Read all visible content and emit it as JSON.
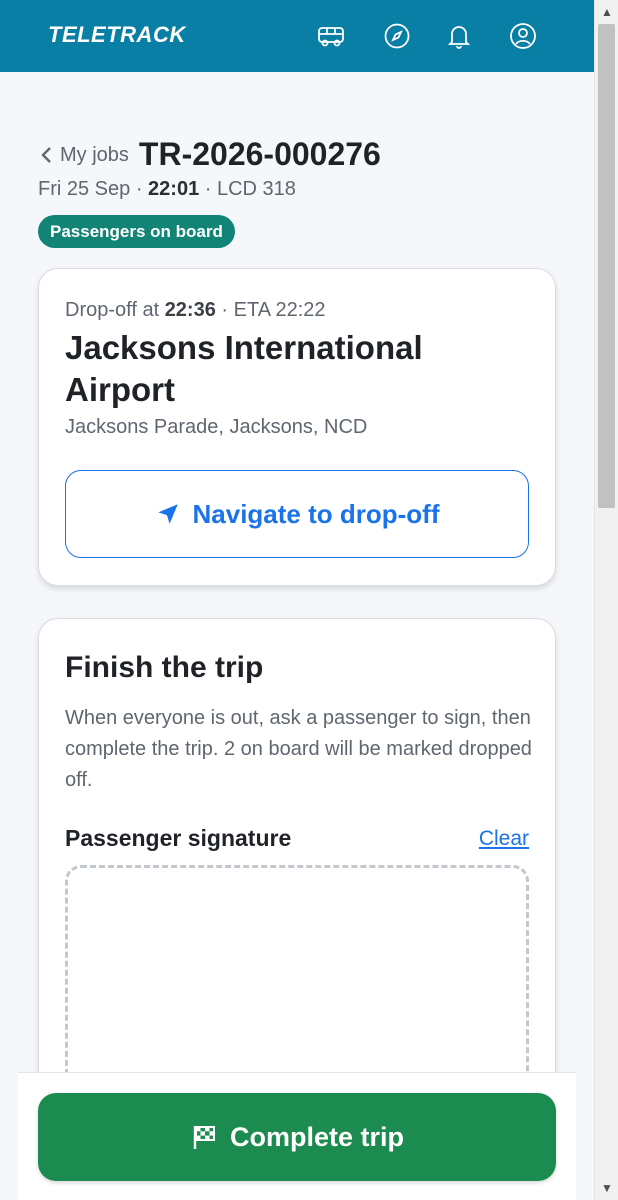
{
  "header": {
    "logo": "TELETRACK",
    "icons": [
      "vehicle-icon",
      "compass-icon",
      "bell-icon",
      "user-icon"
    ]
  },
  "crumb": {
    "back_label": "My jobs",
    "job_id": "TR-2026-000276"
  },
  "meta": {
    "date": "Fri 25 Sep",
    "sep1": " · ",
    "time": "22:01",
    "sep2": " · ",
    "vehicle": "LCD 318"
  },
  "status_badge": "Passengers on board",
  "dropoff_card": {
    "prefix": "Drop-off at ",
    "time": "22:36",
    "eta": " · ETA 22:22",
    "destination": "Jacksons International Airport",
    "address": "Jacksons Parade, Jacksons, NCD",
    "navigate_label": "Navigate to drop-off"
  },
  "finish_card": {
    "title": "Finish the trip",
    "description": "When everyone is out, ask a passenger to sign, then complete the trip. 2 on board will be marked dropped off.",
    "signature_label": "Passenger signature",
    "clear_label": "Clear",
    "signature_marker": "×"
  },
  "complete_button": "Complete trip",
  "colors": {
    "header": "#0a7fa6",
    "badge": "#128476",
    "link": "#1a73e8",
    "complete": "#1c8b4f"
  }
}
